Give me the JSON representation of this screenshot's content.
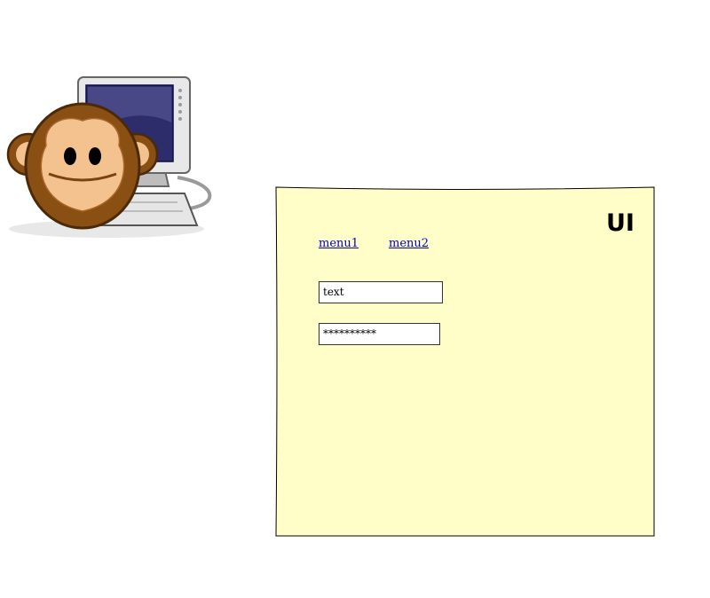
{
  "mockup": {
    "title": "UI",
    "menu": [
      "menu1",
      "menu2"
    ],
    "text_field": {
      "value": "text"
    },
    "password_field": {
      "value": "**********"
    }
  },
  "colors": {
    "sheet_fill": "#fffec8",
    "link": "#0000cc",
    "monkey_fur": "#8a4f12",
    "monkey_face": "#f3c28f",
    "monitor_screen": "#2e2d6b"
  },
  "icons": {
    "illustration": "monkey-at-computer-icon"
  }
}
